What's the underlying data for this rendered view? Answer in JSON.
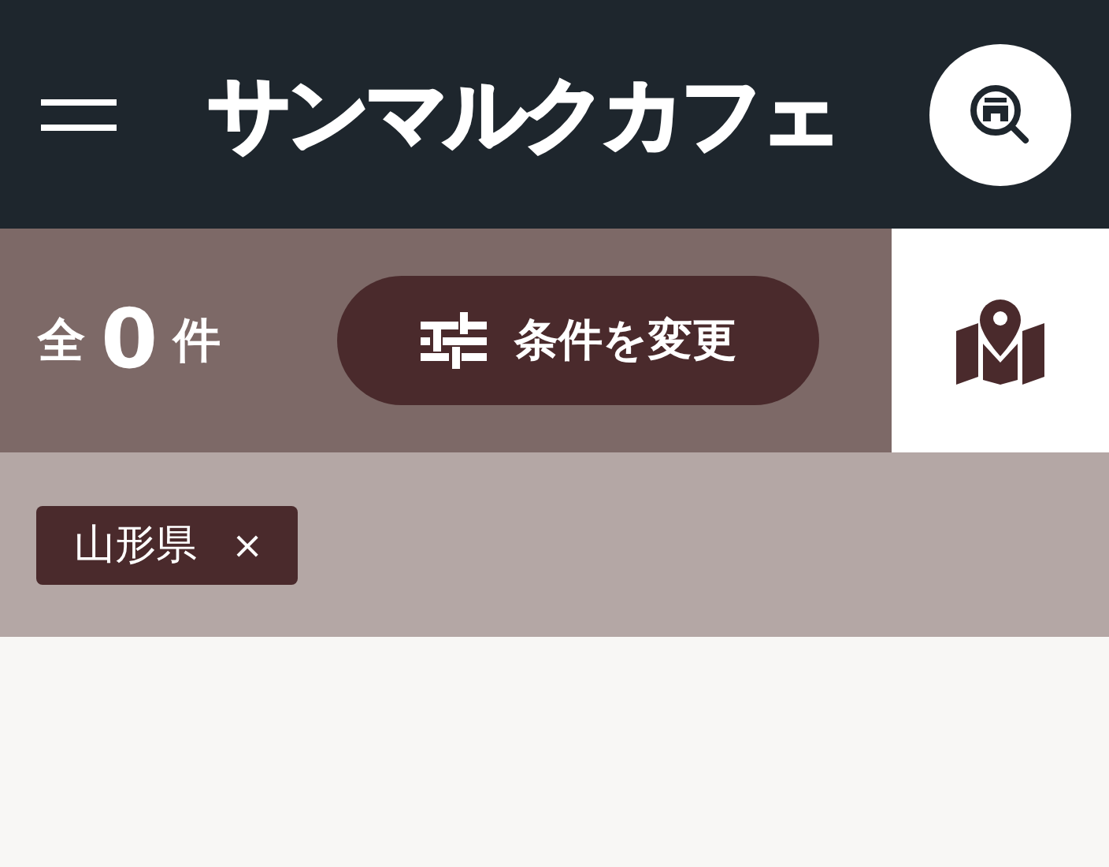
{
  "header": {
    "logo": "サンマルクカフェ"
  },
  "results": {
    "prefix": "全",
    "count": "0",
    "suffix": "件",
    "change_button": "条件を変更"
  },
  "filters": [
    {
      "label": "山形県",
      "remove": "×"
    }
  ]
}
